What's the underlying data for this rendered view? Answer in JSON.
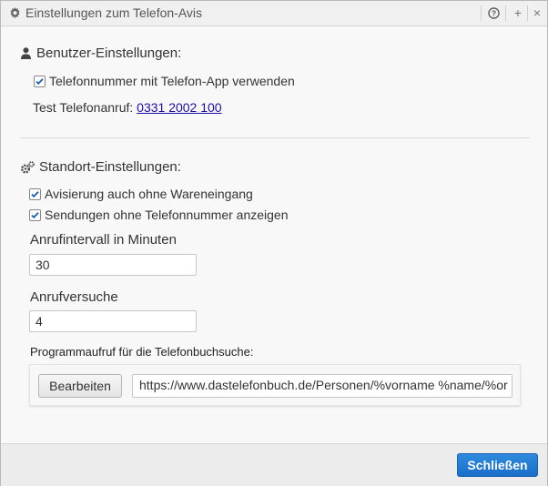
{
  "window": {
    "title": "Einstellungen zum Telefon-Avis",
    "title_icon": "gear-icon",
    "controls": {
      "help": "?",
      "maximize": "+",
      "close": "×"
    }
  },
  "user_settings": {
    "heading": "Benutzer-Einstellungen:",
    "icon": "user-icon",
    "use_phone_app": {
      "label": "Telefonnummer mit Telefon-App verwenden",
      "checked": true
    },
    "test_call_label": "Test Telefonanruf:",
    "test_call_number": "0331 2002 100"
  },
  "location_settings": {
    "heading": "Standort-Einstellungen:",
    "icon": "gears-icon",
    "notify_without_receipt": {
      "label": "Avisierung auch ohne Wareneingang",
      "checked": true
    },
    "show_without_phone": {
      "label": "Sendungen ohne Telefonnummer anzeigen",
      "checked": true
    },
    "interval_label": "Anrufintervall in Minuten",
    "interval_value": "30",
    "attempts_label": "Anrufversuche",
    "attempts_value": "4",
    "program_call_label": "Programmaufruf für die Telefonbuchsuche:",
    "edit_button": "Bearbeiten",
    "url_value": "https://www.dastelefonbuch.de/Personen/%vorname %name/%or"
  },
  "footer": {
    "close_button": "Schließen"
  },
  "colors": {
    "accent": "#1a6fc8",
    "link": "#1a0dab"
  }
}
